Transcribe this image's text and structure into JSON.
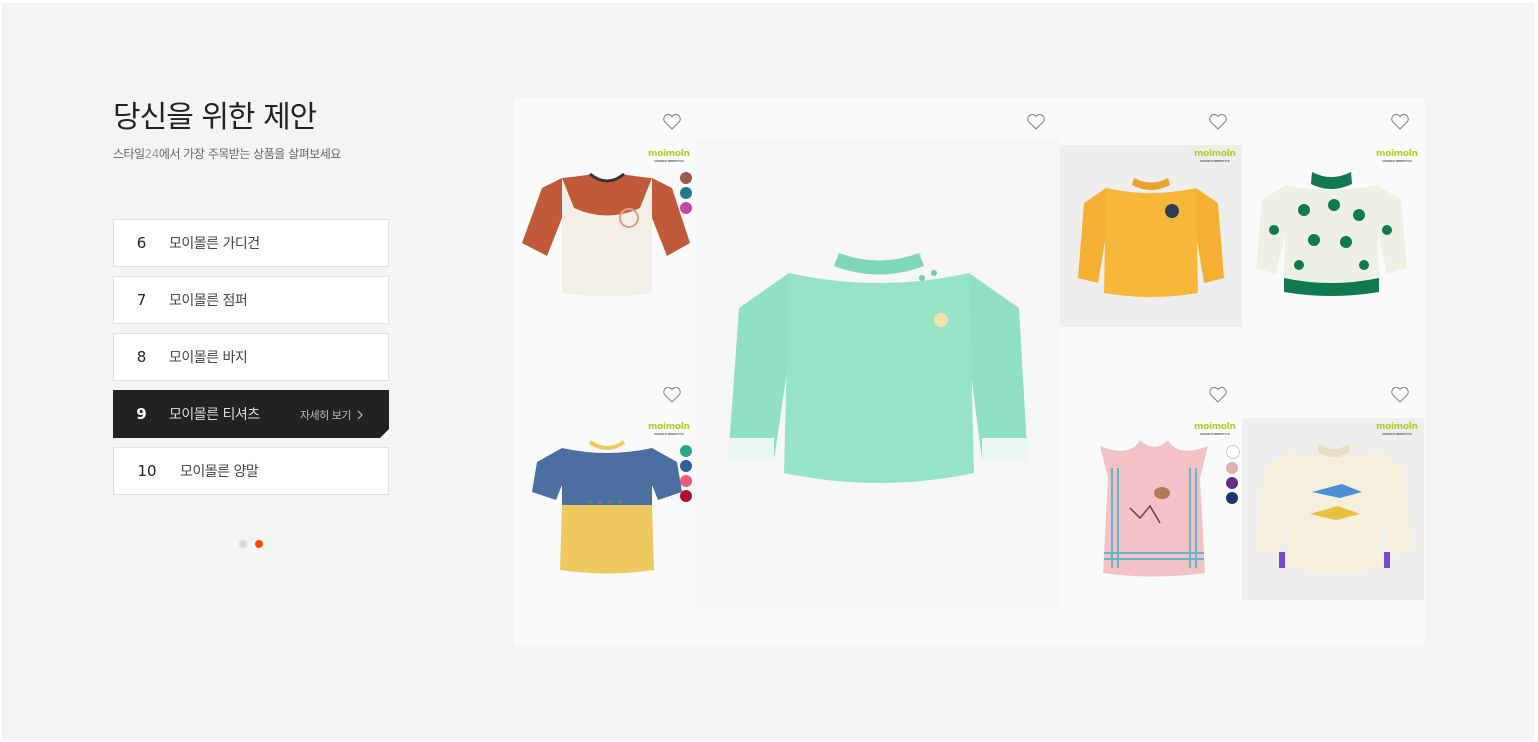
{
  "section": {
    "title": "당신을 위한 제안",
    "subtitle_prefix": "스타일",
    "subtitle_highlight": "24",
    "subtitle_suffix": "에서 가장 주목받는 상품을 살펴보세요"
  },
  "ranking": [
    {
      "num": "6",
      "name": "모이몰른 가디건",
      "active": false
    },
    {
      "num": "7",
      "name": "모이몰른 점퍼",
      "active": false
    },
    {
      "num": "8",
      "name": "모이몰른 바지",
      "active": false
    },
    {
      "num": "9",
      "name": "모이몰른 티셔츠",
      "active": true,
      "more": "자세히 보기"
    },
    {
      "num": "10",
      "name": "모이몰른 양말",
      "active": false
    }
  ],
  "pagination": {
    "pages": 2,
    "current": 2
  },
  "brand": {
    "logo": "moimoln",
    "tagline": "AMIABLE BEBESTYLE"
  },
  "products": [
    {
      "id": "raglan-tee",
      "colors": [
        "#9c5a4a",
        "#237a86",
        "#c04aa8"
      ]
    },
    {
      "id": "mint-sweatshirt",
      "colors": []
    },
    {
      "id": "yellow-sweatshirt",
      "colors": []
    },
    {
      "id": "green-print-sweatshirt",
      "colors": []
    },
    {
      "id": "blue-yellow-tee",
      "colors": [
        "#2aa88a",
        "#2d5f9f",
        "#e85a7e",
        "#b01030"
      ]
    },
    {
      "id": "pink-vest",
      "colors": [
        "#ffffff",
        "#e2b0b0",
        "#6a2a8a",
        "#1e3570"
      ]
    },
    {
      "id": "cream-longsleeve",
      "colors": []
    }
  ],
  "accent_color": "#ff4a00",
  "icons": {
    "heart": "heart-icon",
    "chevron": "chevron-right-icon"
  }
}
